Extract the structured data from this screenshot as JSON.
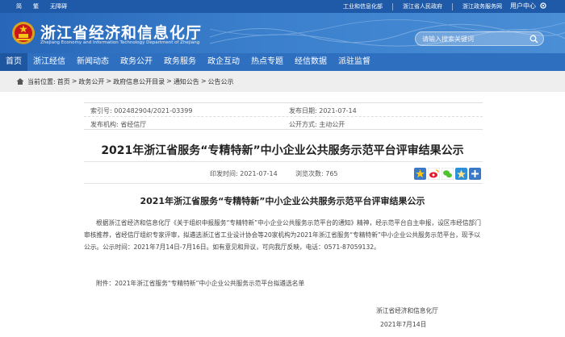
{
  "topbar": {
    "links_left": [
      "简",
      "繁",
      "无障碍"
    ],
    "links_right": [
      "工业和信息化部",
      "浙江省人民政府",
      "浙江政务服务网"
    ],
    "user_center": "用户中心"
  },
  "header": {
    "site_title": "浙江省经济和信息化厅",
    "site_subtitle": "Zhejiang Economy and Information Technology Department of Zhejiang",
    "search_placeholder": "请输入搜索关键词"
  },
  "nav": {
    "items": [
      "首页",
      "浙江经信",
      "新闻动态",
      "政务公开",
      "政务服务",
      "政企互动",
      "热点专题",
      "经信数据",
      "派驻监督"
    ],
    "active_index": 0
  },
  "breadcrumb": {
    "label": "当前位置:",
    "items": [
      "首页",
      "政务公开",
      "政府信息公开目录",
      "通知公告",
      "公告公示"
    ],
    "separator": ">"
  },
  "meta": {
    "index_no": "索引号: 002482904/2021-03399",
    "publish_date": "发布日期: 2021-07-14",
    "publisher": "发布机构: 省经信厅",
    "public_mode": "公开方式: 主动公开"
  },
  "article": {
    "title": "2021年浙江省服务“专精特新”中小企业公共服务示范平台评审结果公示",
    "print_date": "印发时间: 2021-07-14",
    "views": "浏览次数: 765",
    "heading": "2021年浙江省服务“专精特新”中小企业公共服务示范平台评审结果公示",
    "body": "根据浙江省经济和信息化厅《关于组织申报服务“专精特新”中小企业公共服务示范平台的通知》精神，经示范平台自主申报，设区市经信部门审核推荐，省经信厅组织专家评审，拟遴选浙江省工业设计协会等20家机构为2021年浙江省服务“专精特新”中小企业公共服务示范平台，现予以公示。公示时间：2021年7月14日-7月16日。如有意见和异议，可向我厅反映，电话：0571-87059132。",
    "attachment": "附件：2021年浙江省服务“专精特新”中小企业公共服务示范平台拟遴选名单",
    "signature_org": "浙江省经济和信息化厅",
    "signature_date": "2021年7月14日"
  },
  "colors": {
    "topbar": "#1f5aa8",
    "header": "#2f6fc0",
    "nav": "#2f6fc0",
    "nav_active": "#1e56a0",
    "breadcrumb_bg": "#eeeeee"
  }
}
